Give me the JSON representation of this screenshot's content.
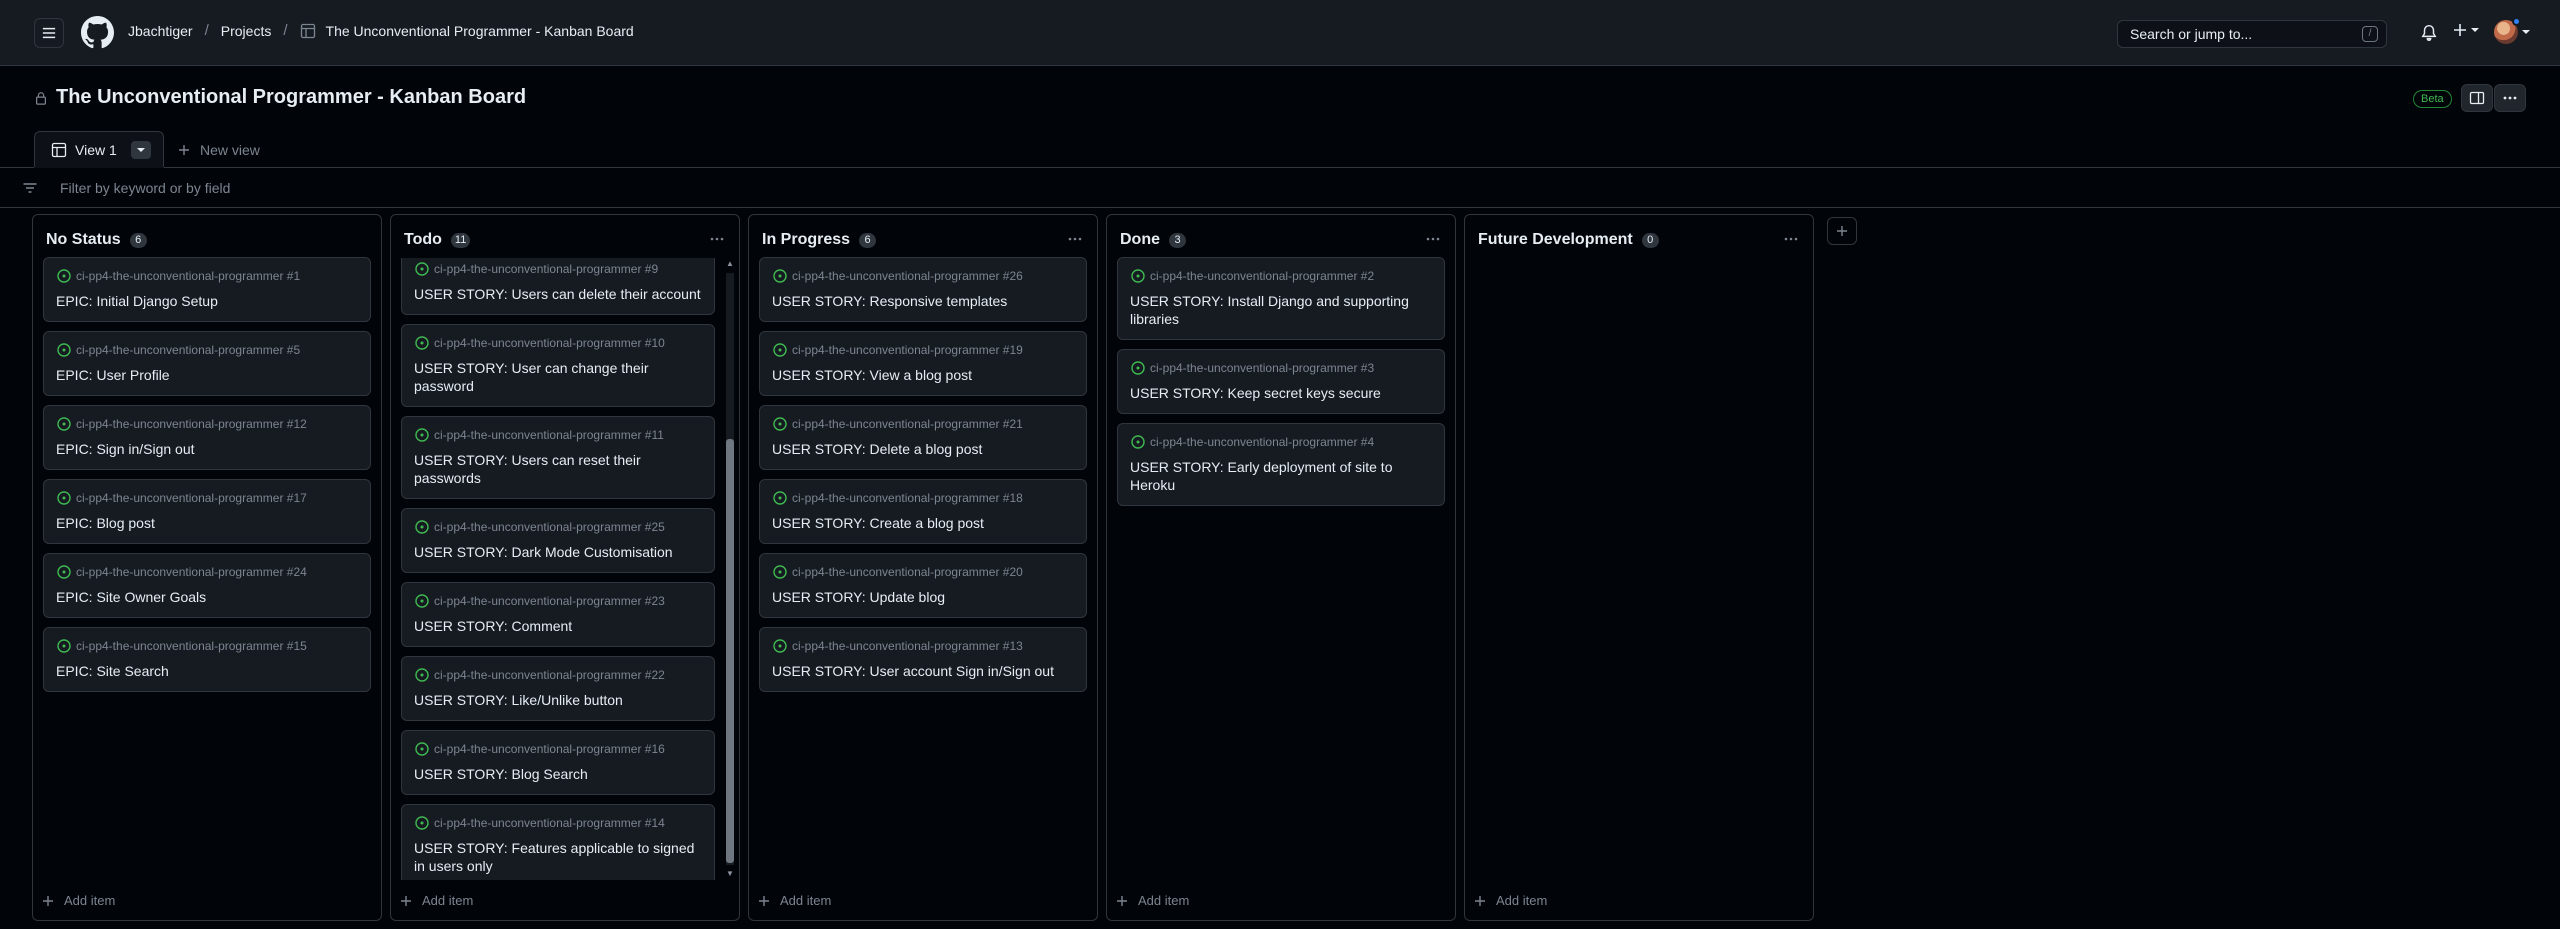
{
  "header": {
    "breadcrumb": [
      "Jbachtiger",
      "Projects",
      "The Unconventional Programmer - Kanban Board"
    ],
    "search_placeholder": "Search or jump to...",
    "search_shortcut": "/"
  },
  "project": {
    "title": "The Unconventional Programmer - Kanban Board",
    "beta_label": "Beta"
  },
  "views": {
    "active_view": "View 1",
    "new_view_label": "New view"
  },
  "filter": {
    "placeholder": "Filter by keyword or by field"
  },
  "add_item_label": "Add item",
  "columns": [
    {
      "name": "No Status",
      "count": "6",
      "cards": [
        {
          "repo": "ci-pp4-the-unconventional-programmer #1",
          "title": "EPIC: Initial Django Setup"
        },
        {
          "repo": "ci-pp4-the-unconventional-programmer #5",
          "title": "EPIC: User Profile"
        },
        {
          "repo": "ci-pp4-the-unconventional-programmer #12",
          "title": "EPIC: Sign in/Sign out"
        },
        {
          "repo": "ci-pp4-the-unconventional-programmer #17",
          "title": "EPIC: Blog post"
        },
        {
          "repo": "ci-pp4-the-unconventional-programmer #24",
          "title": "EPIC: Site Owner Goals"
        },
        {
          "repo": "ci-pp4-the-unconventional-programmer #15",
          "title": "EPIC: Site Search"
        }
      ]
    },
    {
      "name": "Todo",
      "count": "11",
      "cards": [
        {
          "repo": "ci-pp4-the-unconventional-programmer #9",
          "title": "USER STORY: Users can delete their account"
        },
        {
          "repo": "ci-pp4-the-unconventional-programmer #10",
          "title": "USER STORY: User can change their password"
        },
        {
          "repo": "ci-pp4-the-unconventional-programmer #11",
          "title": "USER STORY: Users can reset their passwords"
        },
        {
          "repo": "ci-pp4-the-unconventional-programmer #25",
          "title": "USER STORY: Dark Mode Customisation"
        },
        {
          "repo": "ci-pp4-the-unconventional-programmer #23",
          "title": "USER STORY: Comment"
        },
        {
          "repo": "ci-pp4-the-unconventional-programmer #22",
          "title": "USER STORY: Like/Unlike button"
        },
        {
          "repo": "ci-pp4-the-unconventional-programmer #16",
          "title": "USER STORY: Blog Search"
        },
        {
          "repo": "ci-pp4-the-unconventional-programmer #14",
          "title": "USER STORY: Features applicable to signed in users only"
        }
      ]
    },
    {
      "name": "In Progress",
      "count": "6",
      "cards": [
        {
          "repo": "ci-pp4-the-unconventional-programmer #26",
          "title": "USER STORY: Responsive templates"
        },
        {
          "repo": "ci-pp4-the-unconventional-programmer #19",
          "title": "USER STORY: View a blog post"
        },
        {
          "repo": "ci-pp4-the-unconventional-programmer #21",
          "title": "USER STORY: Delete a blog post"
        },
        {
          "repo": "ci-pp4-the-unconventional-programmer #18",
          "title": "USER STORY: Create a blog post"
        },
        {
          "repo": "ci-pp4-the-unconventional-programmer #20",
          "title": "USER STORY: Update blog"
        },
        {
          "repo": "ci-pp4-the-unconventional-programmer #13",
          "title": "USER STORY: User account Sign in/Sign out"
        }
      ]
    },
    {
      "name": "Done",
      "count": "3",
      "cards": [
        {
          "repo": "ci-pp4-the-unconventional-programmer #2",
          "title": "USER STORY: Install Django and supporting libraries"
        },
        {
          "repo": "ci-pp4-the-unconventional-programmer #3",
          "title": "USER STORY: Keep secret keys secure"
        },
        {
          "repo": "ci-pp4-the-unconventional-programmer #4",
          "title": "USER STORY: Early deployment of site to Heroku"
        }
      ]
    },
    {
      "name": "Future Development",
      "count": "0",
      "cards": []
    }
  ]
}
